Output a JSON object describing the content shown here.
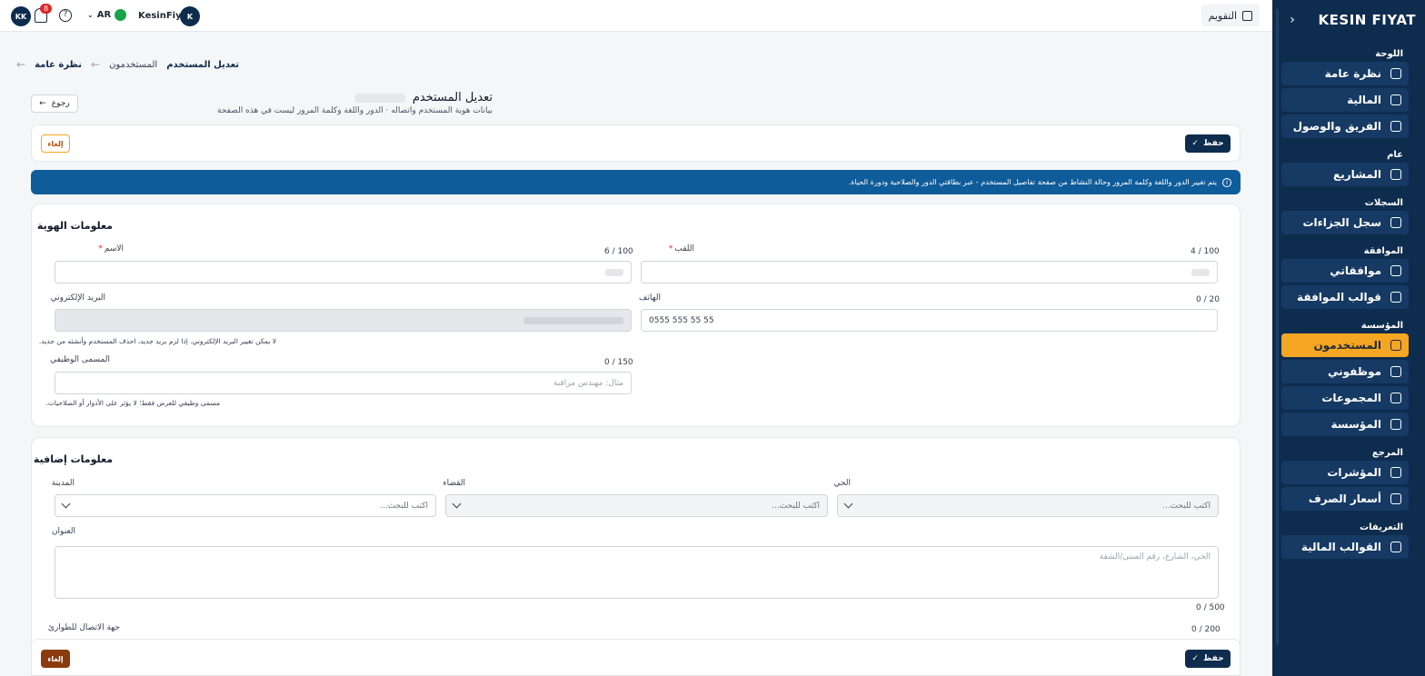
{
  "sidebar": {
    "logo": "KESIN FIYAT",
    "collapse_icon": "chevron-left",
    "groups": [
      {
        "title": "اللوحة",
        "items": [
          {
            "label": "نظرة عامة",
            "icon": "home-icon"
          },
          {
            "label": "المالية",
            "icon": "wallet-icon"
          },
          {
            "label": "الفريق والوصول",
            "icon": "shield-user-icon"
          }
        ]
      },
      {
        "title": "عام",
        "items": [
          {
            "label": "المشاريع",
            "icon": "folder-icon"
          }
        ]
      },
      {
        "title": "السجلات",
        "items": [
          {
            "label": "سجل الجزاءات",
            "icon": "document-icon"
          }
        ]
      },
      {
        "title": "الموافقة",
        "items": [
          {
            "label": "موافقاتي",
            "icon": "clipboard-icon"
          },
          {
            "label": "قوالب الموافقة",
            "icon": "branch-icon"
          }
        ]
      },
      {
        "title": "المؤسسة",
        "items": [
          {
            "label": "المستخدمون",
            "icon": "user-icon",
            "active": true
          },
          {
            "label": "موظفوني",
            "icon": "badge-icon"
          },
          {
            "label": "المجموعات",
            "icon": "users-icon"
          },
          {
            "label": "المؤسسة",
            "icon": "building-icon"
          }
        ]
      },
      {
        "title": "المرجع",
        "items": [
          {
            "label": "المؤشرات",
            "icon": "chart-icon"
          },
          {
            "label": "أسعار الصرف",
            "icon": "globe-icon"
          }
        ]
      },
      {
        "title": "التعريفات",
        "items": [
          {
            "label": "القوالب المالية",
            "icon": "external-icon"
          }
        ]
      }
    ]
  },
  "topbar": {
    "user_initials": "KK",
    "notification_count": "8",
    "language": "AR",
    "company_name": "KesinFiyat",
    "company_initial": "K",
    "calendar_label": "التقويم"
  },
  "breadcrumb": {
    "items": [
      "تعديل المستخدم",
      "المستخدمون",
      "نظرة عامة"
    ]
  },
  "page": {
    "title": "تعديل المستخدم",
    "subtitle": "بيانات هوية المستخدم واتصاله · الدور واللغة وكلمة المرور ليست في هذه الصفحة",
    "back_label": "رجوع"
  },
  "actions": {
    "save_label": "حفظ",
    "cancel_label": "إلغاء"
  },
  "banner": {
    "text": "يتم تغيير الدور واللغة وكلمة المرور وحالة النشاط من صفحة تفاصيل المستخدم - عبر بطاقتي الدور والصلاحية ودورة الحياة."
  },
  "identity": {
    "title": "معلومات الهوية",
    "name_label": "الاسم",
    "name_counter": "6 / 100",
    "surname_label": "اللقب",
    "surname_counter": "4 / 100",
    "email_label": "البريد الإلكتروني",
    "email_hint": "لا يمكن تغيير البريد الإلكتروني. إذا لزم بريد جديد، احذف المستخدم وأنشئه من جديد.",
    "phone_label": "الهاتف",
    "phone_counter": "0 / 20",
    "phone_placeholder": "0555 555 55 55",
    "job_label": "المسمى الوظيفي",
    "job_counter": "0 / 150",
    "job_placeholder": "مثال: مهندس مراقبة",
    "job_hint": "مسمى وظيفي للعرض فقط؛ لا يؤثر على الأدوار أو الصلاحيات."
  },
  "extra": {
    "title": "معلومات إضافية",
    "city_label": "المدينة",
    "district_label": "القضاء",
    "neighborhood_label": "الحي",
    "search_placeholder": "اكتب للبحث...",
    "address_label": "العنوان",
    "address_placeholder": "الحي، الشارع، رقم المبنى/الشقة",
    "address_counter": "0 / 500",
    "emergency_label": "جهة الاتصال للطوارئ",
    "emergency_counter": "0 / 200"
  }
}
